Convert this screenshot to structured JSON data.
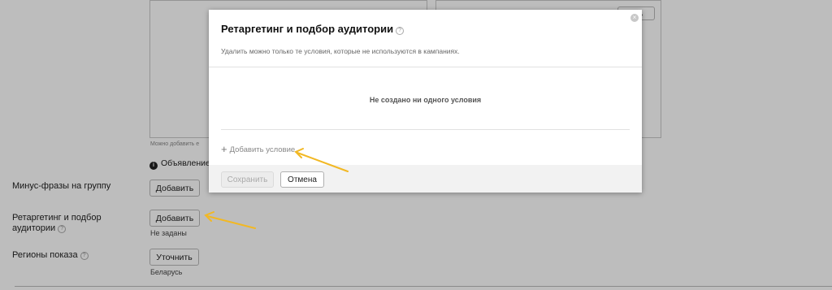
{
  "background": {
    "textarea_hint": "Можно добавить е",
    "right_box_button": "ить",
    "ad_notice": "Объявление т",
    "rows": [
      {
        "label": "Минус-фразы на группу",
        "button": "Добавить",
        "status": ""
      },
      {
        "label": "Ретаргетинг и подбор аудитории",
        "button": "Добавить",
        "status": "Не заданы"
      },
      {
        "label": "Регионы показа",
        "button": "Уточнить",
        "status": "Беларусь"
      }
    ]
  },
  "modal": {
    "title": "Ретаргетинг и подбор аудитории",
    "subtitle": "Удалить можно только те условия, которые не используются в кампаниях.",
    "empty_message": "Не создано ни одного условия",
    "add_condition": "Добавить условие",
    "close_glyph": "×",
    "save_label": "Сохранить",
    "cancel_label": "Отмена"
  },
  "icons": {
    "help": "?",
    "info": "i",
    "plus": "+"
  },
  "colors": {
    "arrow": "#f2b824",
    "overlay": "rgba(0,0,0,0.26)"
  }
}
